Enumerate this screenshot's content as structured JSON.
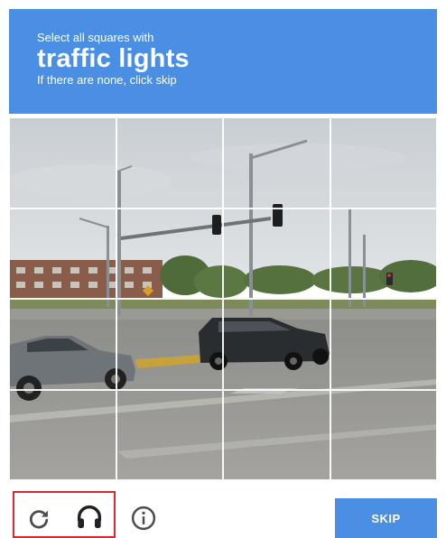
{
  "header": {
    "instruction": "Select all squares with",
    "target": "traffic lights",
    "hint": "If there are none, click skip"
  },
  "grid": {
    "rows": 4,
    "cols": 4
  },
  "footer": {
    "reload_icon": "reload-icon",
    "audio_icon": "headphones-icon",
    "info_icon": "info-icon",
    "skip_label": "SKIP"
  },
  "colors": {
    "header_bg": "#4a8fe4",
    "skip_bg": "#4a8fe4",
    "highlight": "#e0262c",
    "icon": "#4d4d4d"
  }
}
